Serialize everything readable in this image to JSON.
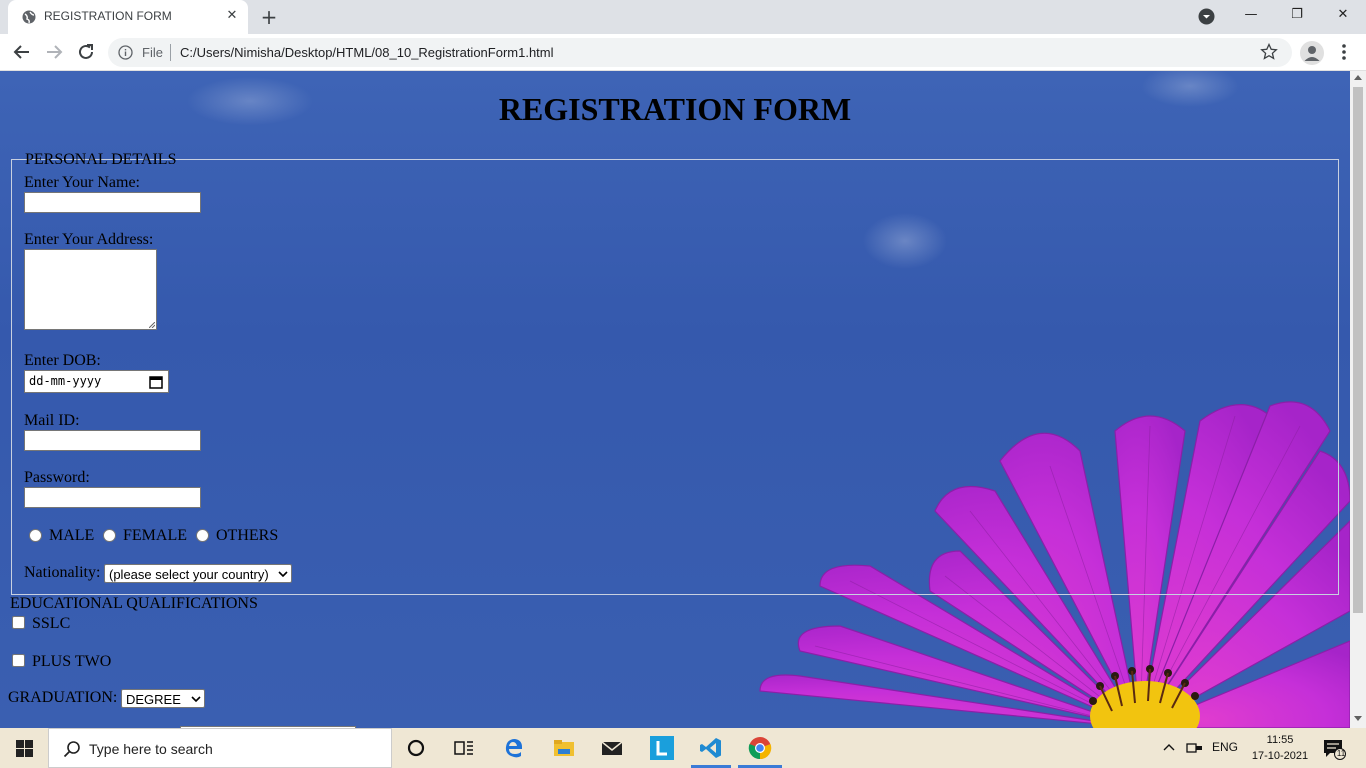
{
  "browser": {
    "tab_title": "REGISTRATION FORM",
    "tab_close": "✕",
    "new_tab": "+",
    "file_label": "File",
    "url": "C:/Users/Nimisha/Desktop/HTML/08_10_RegistrationForm1.html",
    "window_controls": {
      "minimize": "—",
      "restore": "❐",
      "close": "✕"
    }
  },
  "form": {
    "title": "REGISTRATION FORM",
    "personal_legend": "PERSONAL DETAILS",
    "name_label": "Enter Your Name:",
    "name_value": "",
    "address_label": "Enter Your Address:",
    "address_value": "",
    "dob_label": "Enter DOB:",
    "dob_placeholder": "dd-mm-yyyy",
    "mail_label": "Mail ID:",
    "mail_value": "",
    "password_label": "Password:",
    "password_value": "",
    "gender_options": [
      "MALE",
      "FEMALE",
      "OTHERS"
    ],
    "nationality_label": "Nationality:",
    "nationality_selected": "(please select your country)",
    "education_heading": "EDUCATIONAL QUALIFICATIONS",
    "education_options": [
      "SSLC",
      "PLUS TWO"
    ],
    "graduation_label": "GRADUATION:",
    "graduation_selected": "DEGREE"
  },
  "taskbar": {
    "search_placeholder": "Type here to search",
    "language": "ENG",
    "time": "11:55",
    "date": "17-10-2021",
    "notification_count": "11"
  },
  "colors": {
    "page_background": "#3a5fb1",
    "flower": "#c82fd6",
    "flower_center": "#f2c40f"
  }
}
